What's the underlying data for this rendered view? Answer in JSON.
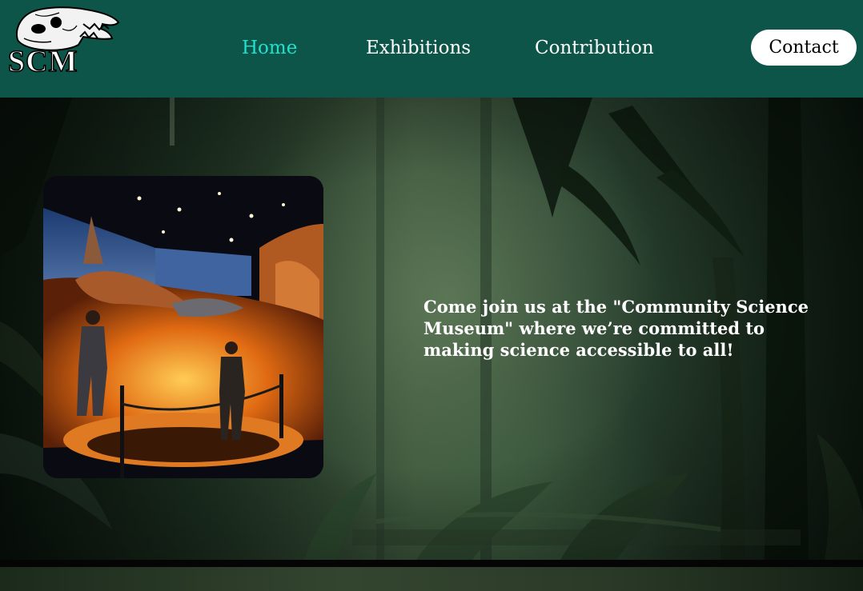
{
  "header": {
    "logo_text": "SCM",
    "logo_icon": "t-rex-skull-icon",
    "nav": {
      "home": "Home",
      "exhibitions": "Exhibitions",
      "contribution": "Contribution"
    },
    "contact_label": "Contact",
    "active_nav": "Home"
  },
  "hero": {
    "text": "Come join us at the \"Community Science Museum\" where we’re committed to making science accessible to all!",
    "image": "museum-exhibit-dinosaur-lava-photo",
    "background": "jungle-forest-background"
  },
  "colors": {
    "header_bg": "#0d5548",
    "active_nav": "#22e0d0",
    "nav_text": "#ffffff",
    "contact_bg": "#ffffff",
    "contact_text": "#000000"
  }
}
